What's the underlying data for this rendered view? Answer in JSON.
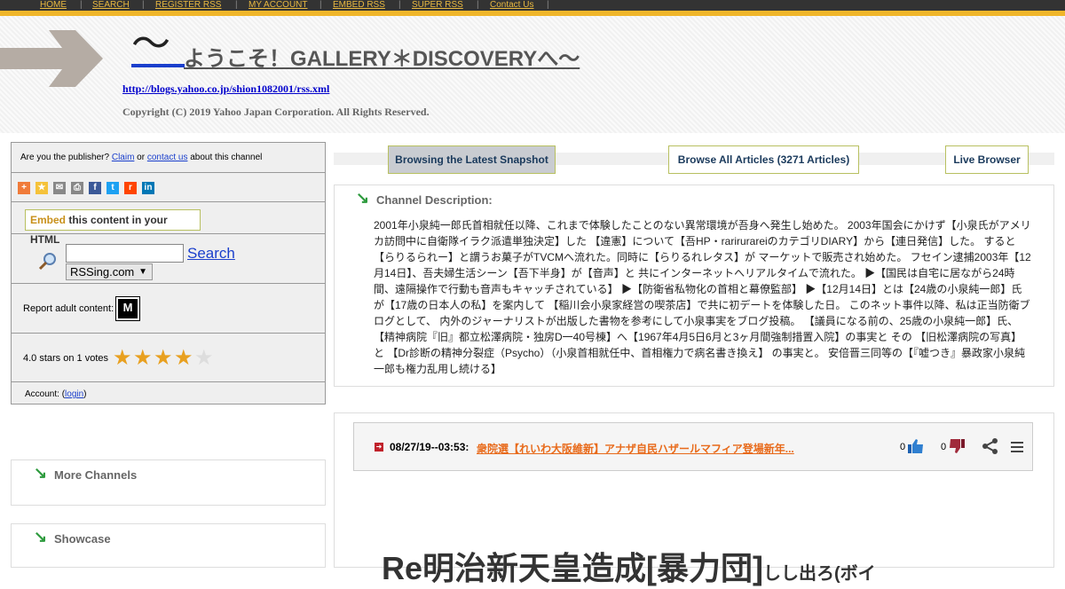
{
  "nav": [
    "HOME",
    "SEARCH",
    "REGISTER RSS",
    "MY ACCOUNT",
    "EMBED RSS",
    "SUPER RSS",
    "Contact Us"
  ],
  "header": {
    "tilde": "～",
    "title": "ようこそ！GALLERY＊DISCOVERYへ～",
    "feed_url": "http://blogs.yahoo.co.jp/shion1082001/rss.xml",
    "copyright": "Copyright (C) 2019 Yahoo Japan Corporation. All Rights Reserved."
  },
  "sidebar": {
    "publisher_text_1": "Are you the publisher? ",
    "claim": "Claim",
    "or": " or ",
    "contact": "contact us",
    "publisher_text_2": " about this channel",
    "embed_word": "Embed",
    "embed_rest": " this content in your HTML",
    "search_label": "Search",
    "search_value": "",
    "select_value": "RSSing.com",
    "adult_label": "Report adult content:",
    "adult_icon": "M",
    "rating_text": "4.0 stars on 1 votes",
    "rating": 4,
    "rating_max": 5,
    "account_label": "Account: (",
    "login": "login",
    "account_close": ")",
    "more_channels": "More Channels",
    "showcase": "Showcase"
  },
  "tabs": {
    "latest": "Browsing the Latest Snapshot",
    "all": "Browse All Articles (3271 Articles)",
    "live": "Live Browser"
  },
  "description": {
    "title": "Channel Description:",
    "body": "2001年小泉純一郎氏首相就任以降、これまで体験したことのない異常環境が吾身へ発生し始めた。 2003年国会にかけず【小泉氏がアメリカ訪問中に自衛隊イラク派遣単独決定】した 【違憲】について【吾HP・rarirurareiのカテゴリDIARY】から【連日発信】した。 すると 【らりるられー】と謂うお菓子がTVCMへ流れた。同時に【らりるれレタス】が マーケットで販売され始めた。 フセイン逮捕2003年【12月14日】、吾夫婦生活シーン【吾下半身】が【音声】と 共にインターネットへリアルタイムで流れた。 ▶【国民は自宅に居ながら24時間、遠隔操作で行動も音声もキャッチされている】 ▶【防衛省私物化の首相と幕僚監部】 ▶【12月14日】とは【24歳の小泉純一郎】氏が【17歳の日本人の私】を案内して 【稲川会小泉家経営の喫茶店】で共に初デートを体験した日。 このネット事件以降、私は正当防衛ブログとして、 内外のジャーナリストが出版した書物を参考にして小泉事実をブログ投稿。 【議員になる前の、25歳の小泉純一郎】氏、 【精神病院『旧』都立松澤病院・独房D一40号棟】へ【1967年4月5日6月と3ヶ月間強制措置入院】の事実と その 【旧松澤病院の写真】と 【Dr診断の精神分裂症（Psycho）（小泉首相就任中、首相権力で病名書き換え】 の事実と。 安倍晋三同等の【『嘘つき』暴政家小泉純一郎も権力乱用し続ける】"
  },
  "article": {
    "date": "08/27/19--03:53:",
    "title": "衆院選【れいわ大阪維新】アナザ自民ハザールマフィア登場新年...",
    "up_count": "0",
    "down_count": "0"
  },
  "heading": {
    "main": "Re明治新天皇造成[暴力団]",
    "tail": "しし出ろ(ボイ"
  },
  "colors": {
    "accent": "#f0b62a",
    "link": "#1a3fcc",
    "article_link": "#e86a1a",
    "arrow": "#2e9b3e"
  }
}
